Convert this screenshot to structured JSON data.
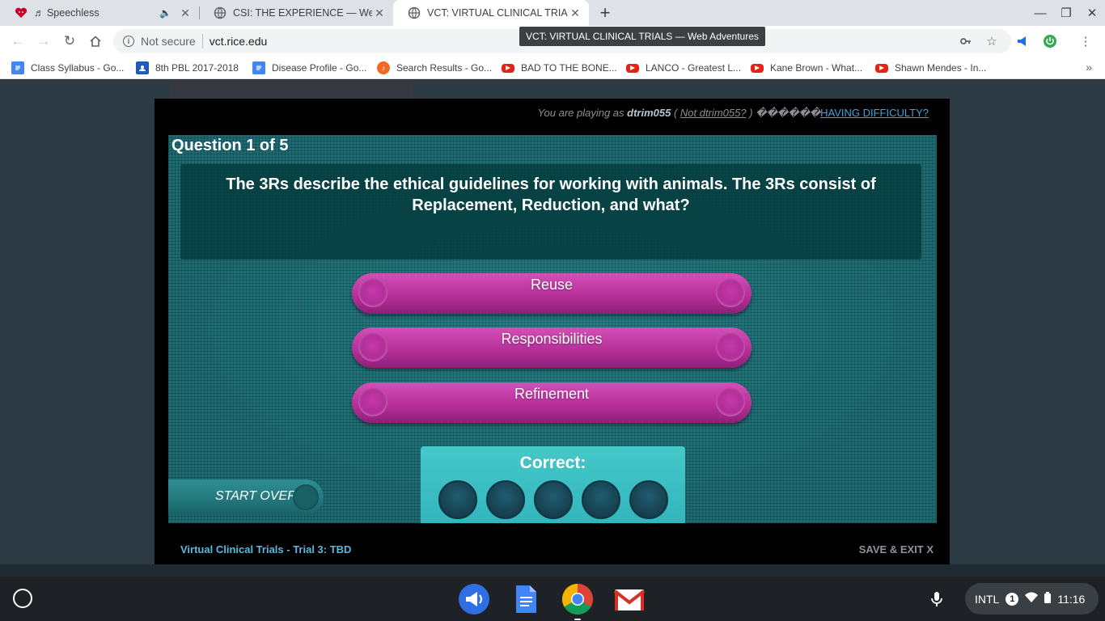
{
  "browser": {
    "tabs": [
      {
        "title": "♬ Speechless",
        "icon": "iheart-icon"
      },
      {
        "title": "CSI: THE EXPERIENCE — Web Ac",
        "icon": "globe-icon"
      },
      {
        "title": "VCT: VIRTUAL CLINICAL TRIALS",
        "icon": "globe-icon"
      }
    ],
    "security_label": "Not secure",
    "url": "vct.rice.edu",
    "tooltip": "VCT: VIRTUAL CLINICAL TRIALS — Web Adventures",
    "bookmarks": [
      {
        "label": "Class Syllabus - Go...",
        "icon": "docs-icon",
        "color": "#4285f4"
      },
      {
        "label": "8th PBL 2017-2018",
        "icon": "classroom-icon",
        "color": "#1e5bb8"
      },
      {
        "label": "Disease Profile - Go...",
        "icon": "docs-icon",
        "color": "#4285f4"
      },
      {
        "label": "Search Results - Go...",
        "icon": "music-icon",
        "color": "#f26722"
      },
      {
        "label": "BAD TO THE BONE...",
        "icon": "youtube-icon",
        "color": "#e62117"
      },
      {
        "label": "LANCO - Greatest L...",
        "icon": "youtube-icon",
        "color": "#e62117"
      },
      {
        "label": "Kane Brown - What...",
        "icon": "youtube-icon",
        "color": "#e62117"
      },
      {
        "label": "Shawn Mendes - In...",
        "icon": "youtube-icon",
        "color": "#e62117"
      }
    ],
    "bookmarks_more": "»"
  },
  "game": {
    "playing_prefix": "You are playing as",
    "username": "dtrim055",
    "not_user": "Not dtrim055?",
    "garbled": "������",
    "difficulty": "HAVING DIFFICULTY?",
    "question_number": "Question 1 of 5",
    "question_text": "The 3Rs describe the ethical guidelines for working with animals. The 3Rs consist of Replacement, Reduction, and what?",
    "answers": [
      "Reuse",
      "Responsibilities",
      "Refinement"
    ],
    "correct_label": "Correct:",
    "correct_count": 0,
    "correct_total": 5,
    "start_over": "START OVER",
    "footer_title": "Virtual Clinical Trials - Trial 3: TBD",
    "save_exit": "SAVE & EXIT X"
  },
  "shelf": {
    "input_method": "INTL",
    "notification_count": "1",
    "time": "11:16"
  }
}
